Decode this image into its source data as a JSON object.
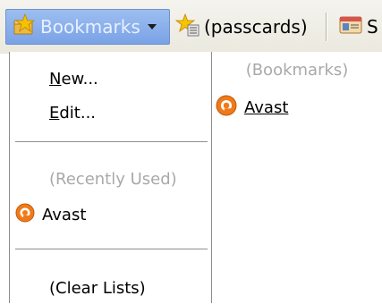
{
  "toolbar": {
    "bookmarks_button": {
      "label": "Bookmarks",
      "icon": "star-folder-icon"
    },
    "passcards_button": {
      "label": "(passcards)",
      "icon": "star-list-icon"
    },
    "third_button": {
      "label": "S",
      "icon": "id-card-icon"
    }
  },
  "menu": {
    "new_label": "ew...",
    "new_mnemonic": "N",
    "edit_label": "dit...",
    "edit_mnemonic": "E",
    "recently_used_header": "(Recently Used)",
    "recent_item": {
      "label": "Avast",
      "icon": "avast-icon"
    },
    "clear_lists": "(Clear Lists)"
  },
  "panel": {
    "header": "(Bookmarks)",
    "item": {
      "label": "Avast",
      "icon": "avast-icon"
    }
  },
  "colors": {
    "active_button": "#8eb2ec",
    "disabled_text": "#a9a9a9",
    "avast_orange": "#f07a1a"
  }
}
